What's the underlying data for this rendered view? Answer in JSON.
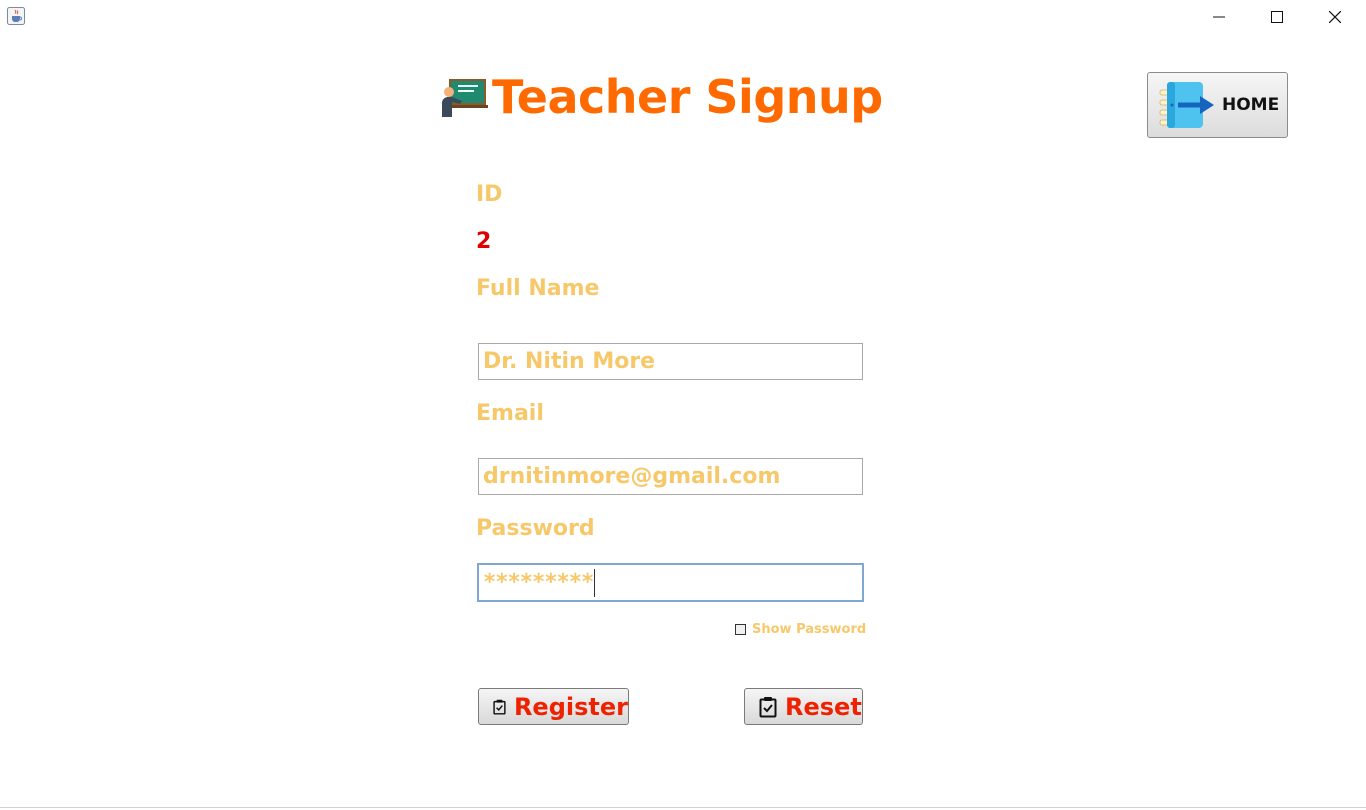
{
  "window": {
    "app_icon": "java-cup-icon",
    "controls": [
      "minimize-icon",
      "maximize-icon",
      "close-icon"
    ]
  },
  "header": {
    "title": "Teacher Signup",
    "title_icon": "teacher-board-icon",
    "home_button": {
      "label": "HOME",
      "icon": "notebook-arrow-icon"
    }
  },
  "form": {
    "id_label": "ID",
    "id_value": "2",
    "fullname_label": "Full Name",
    "fullname_value": "Dr. Nitin More",
    "email_label": "Email",
    "email_value": "drnitinmore@gmail.com",
    "password_label": "Password",
    "password_masked": "*********",
    "show_password_label": "Show Password",
    "show_password_checked": false
  },
  "actions": {
    "register_label": "Register",
    "reset_label": "Reset",
    "icon": "clipboard-check-icon"
  },
  "colors": {
    "title": "#ff6a00",
    "label": "#f7c86a",
    "id_value": "#e00000",
    "action_text": "#ee2200"
  }
}
